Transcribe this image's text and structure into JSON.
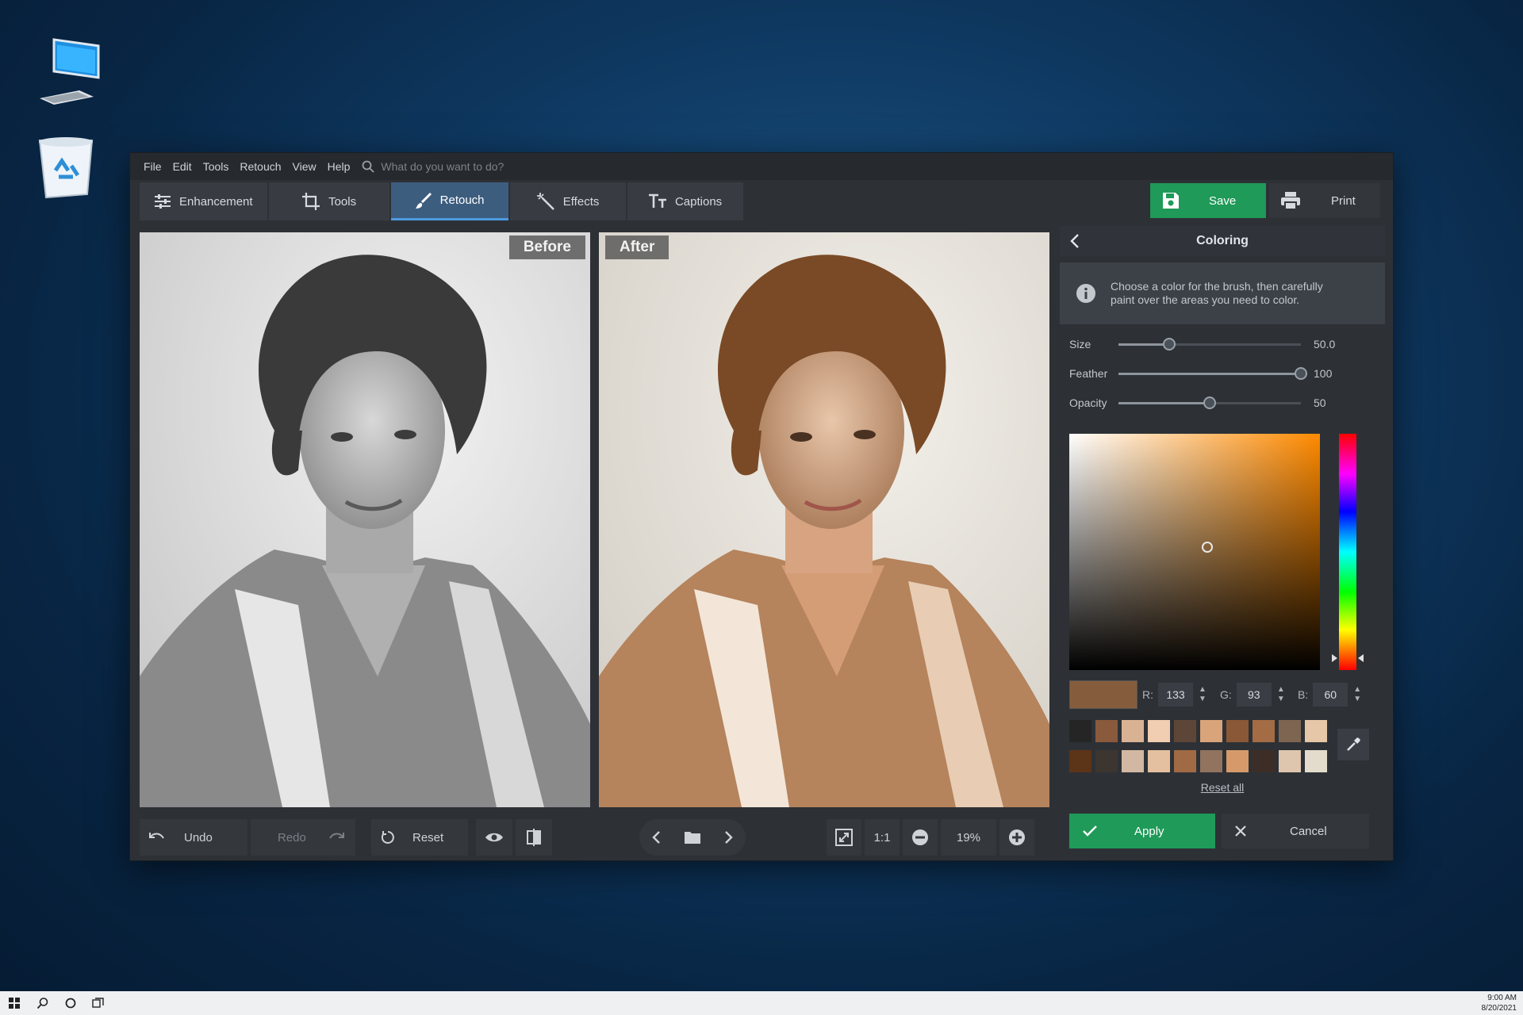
{
  "menubar": {
    "items": [
      "File",
      "Edit",
      "Tools",
      "Retouch",
      "View",
      "Help"
    ],
    "search_placeholder": "What do you want to do?"
  },
  "toolbar": {
    "tabs": [
      {
        "label": "Enhancement",
        "icon": "sliders-icon"
      },
      {
        "label": "Tools",
        "icon": "crop-icon"
      },
      {
        "label": "Retouch",
        "icon": "brush-icon",
        "active": true
      },
      {
        "label": "Effects",
        "icon": "magic-wand-icon"
      },
      {
        "label": "Captions",
        "icon": "text-icon"
      }
    ],
    "save_label": "Save",
    "print_label": "Print"
  },
  "compare": {
    "before_label": "Before",
    "after_label": "After"
  },
  "bottombar": {
    "undo_label": "Undo",
    "redo_label": "Redo",
    "reset_label": "Reset",
    "one_to_one_label": "1:1",
    "zoom_value": "19%"
  },
  "panel": {
    "title": "Coloring",
    "info_text_line1": "Choose a color for the brush, then carefully",
    "info_text_line2": "paint over the areas you need to color.",
    "sliders": [
      {
        "label": "Size",
        "value": "50.0",
        "fraction": 0.28
      },
      {
        "label": "Feather",
        "value": "100",
        "fraction": 1.0
      },
      {
        "label": "Opacity",
        "value": "50",
        "fraction": 0.5
      }
    ],
    "picker": {
      "saturation": 0.55,
      "brightness": 0.52,
      "hue_fraction": 0.95
    },
    "rgb": {
      "r_label": "R:",
      "r": "133",
      "g_label": "G:",
      "g": "93",
      "b_label": "B:",
      "b": "60"
    },
    "current_color": "#855d3c",
    "palette": [
      "#252525",
      "#8a5a3c",
      "#d9b294",
      "#f1cdb1",
      "#5d4637",
      "#d9a47a",
      "#8a5836",
      "#a36c44",
      "#7e6552",
      "#e6c7a8",
      "#5c3418",
      "#3d3530",
      "#d2b8a2",
      "#e4c0a0",
      "#a06a44",
      "#917360",
      "#d69a6a",
      "#3c2e26",
      "#ddc6ad",
      "#e3dccd"
    ],
    "reset_all_label": "Reset all",
    "apply_label": "Apply",
    "cancel_label": "Cancel"
  },
  "taskbar": {
    "time": "9:00 AM",
    "date": "8/20/2021"
  },
  "colors": {
    "accent_green": "#1f9a58",
    "active_tab": "#3d5d7f",
    "accent_blue": "#4c9be0"
  }
}
